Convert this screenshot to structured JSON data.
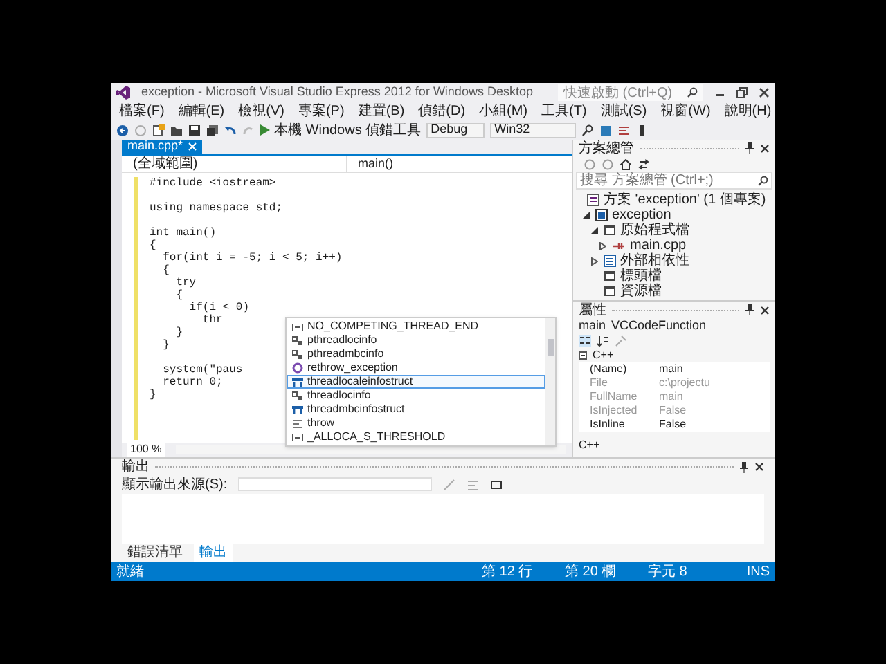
{
  "window": {
    "title": "exception - Microsoft Visual Studio Express 2012 for Windows Desktop",
    "quick_launch": {
      "placeholder": "快速啟動 (Ctrl+Q)"
    }
  },
  "menu": [
    "檔案(F)",
    "編輯(E)",
    "檢視(V)",
    "專案(P)",
    "建置(B)",
    "偵錯(D)",
    "小組(M)",
    "工具(T)",
    "測試(S)",
    "視窗(W)",
    "說明(H)"
  ],
  "toolbar": {
    "debugger": "本機 Windows 偵錯工具",
    "configuration": "Debug",
    "platform": "Win32"
  },
  "editor": {
    "tabs": [
      {
        "label": "main.cpp*",
        "selected": true
      }
    ],
    "scope": "(全域範圍)",
    "member": "main()",
    "code_blocks": [
      [
        "#include <iostream>"
      ],
      [
        "using namespace std;"
      ],
      [
        "int main()",
        "{",
        "  for(int i = -5; i < 5; i++)",
        "  {",
        "    try",
        "    {",
        "      if(i < 0)",
        "        thr",
        "    }",
        "  }"
      ],
      [
        "  system(\"paus",
        "  return 0;",
        "}"
      ]
    ],
    "zoom": "100 %",
    "completion": [
      {
        "label": "NO_COMPETING_THREAD_END",
        "kind": "macro",
        "selected": false
      },
      {
        "label": "pthreadlocinfo",
        "kind": "typedef",
        "selected": false
      },
      {
        "label": "pthreadmbcinfo",
        "kind": "typedef",
        "selected": false
      },
      {
        "label": "rethrow_exception",
        "kind": "function",
        "selected": false
      },
      {
        "label": "threadlocaleinfostruct",
        "kind": "struct",
        "selected": true
      },
      {
        "label": "threadlocinfo",
        "kind": "typedef",
        "selected": false
      },
      {
        "label": "threadmbcinfostruct",
        "kind": "struct",
        "selected": false
      },
      {
        "label": "throw",
        "kind": "keyword",
        "selected": false
      },
      {
        "label": "_ALLOCA_S_THRESHOLD",
        "kind": "macro",
        "selected": false
      }
    ]
  },
  "solution_explorer": {
    "title": "方案總管",
    "search": {
      "placeholder": "搜尋 方案總管 (Ctrl+;)"
    },
    "tree": [
      {
        "label": "方案 'exception' (1 個專案)",
        "kind": "solution",
        "children": [
          {
            "label": "exception",
            "kind": "project",
            "expanded": true,
            "children": [
              {
                "label": "原始程式檔",
                "kind": "folder",
                "expanded": true,
                "children": [
                  {
                    "label": "main.cpp",
                    "kind": "cpp",
                    "expanded": false
                  }
                ]
              },
              {
                "label": "外部相依性",
                "kind": "references",
                "expanded": false
              },
              {
                "label": "標頭檔",
                "kind": "folder"
              },
              {
                "label": "資源檔",
                "kind": "folder"
              }
            ]
          }
        ]
      }
    ]
  },
  "properties": {
    "title": "屬性",
    "object": "main",
    "type": "VCCodeFunction",
    "category": "C++",
    "rows": [
      {
        "name": "(Name)",
        "value": "main",
        "readonly": false
      },
      {
        "name": "File",
        "value": "c:\\projectu",
        "readonly": true
      },
      {
        "name": "FullName",
        "value": "main",
        "readonly": true
      },
      {
        "name": "IsInjected",
        "value": "False",
        "readonly": true
      },
      {
        "name": "IsInline",
        "value": "False",
        "readonly": false
      }
    ],
    "description": "C++"
  },
  "output": {
    "title": "輸出",
    "source_label": "顯示輸出來源(S):",
    "tabs": [
      {
        "label": "錯誤清單",
        "selected": false
      },
      {
        "label": "輸出",
        "selected": true
      }
    ]
  },
  "status_bar": {
    "message": "就緒",
    "line": "第 12 行",
    "column": "第 20 欄",
    "char": "字元 8",
    "mode": "INS"
  }
}
